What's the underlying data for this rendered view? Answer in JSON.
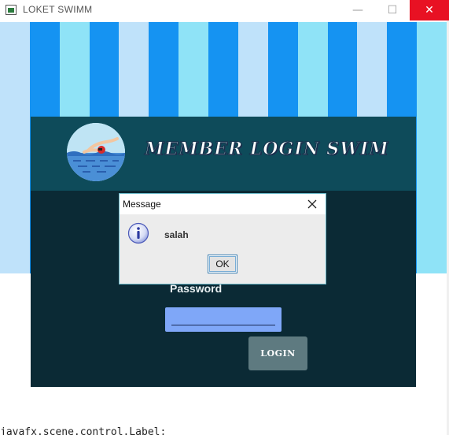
{
  "window": {
    "title": "LOKET SWIMM",
    "minimize_glyph": "—",
    "maximize_glyph": "☐",
    "close_glyph": "✕"
  },
  "background": {
    "stripe_colors": [
      "#bfe2fa",
      "#1593f2",
      "#8fe3f7",
      "#1593f2",
      "#bfe2fa",
      "#1593f2",
      "#8fe3f7",
      "#1593f2",
      "#bfe2fa",
      "#1593f2",
      "#8fe3f7",
      "#1593f2",
      "#bfe2fa",
      "#1593f2",
      "#8fe3f7"
    ]
  },
  "login": {
    "title": "MEMBER LOGIN SWIM",
    "password_label": "Password",
    "login_button_label": "LOGIN"
  },
  "dialog": {
    "title": "Message",
    "message": "salah",
    "ok_label": "OK",
    "icon": "info-icon"
  },
  "console": {
    "text": "javafx.scene.control.Label;"
  },
  "colors": {
    "card_bg": "#0b2a35",
    "card_header_bg": "#0e4b5a",
    "input_bg": "#7fa7f8",
    "login_button_bg": "#5e7a80"
  }
}
